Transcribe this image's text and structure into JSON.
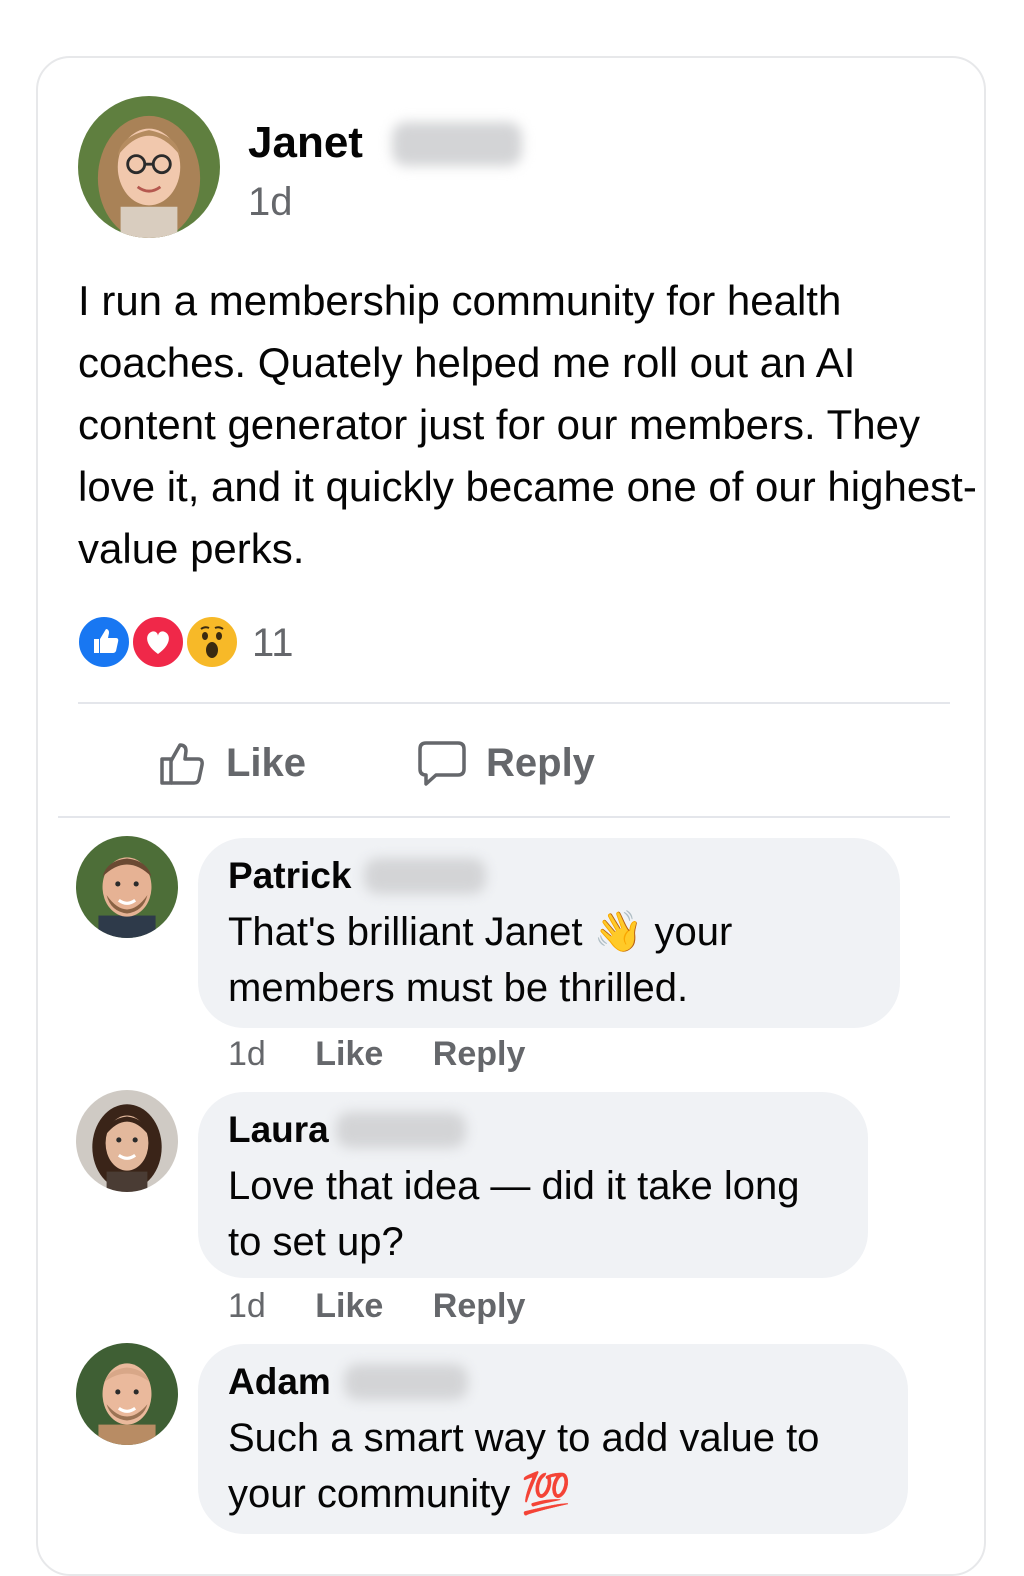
{
  "post": {
    "author": "Janet",
    "time": "1d",
    "body": "I run a membership community for health coaches. Quately helped me roll out an AI content generator just for our members. They love it, and it quickly became one of our highest-value perks.",
    "reactions": {
      "types": [
        "like-reaction",
        "love-reaction",
        "wow-reaction"
      ],
      "count": "11",
      "colors": {
        "like": "#1877f2",
        "love": "#f02849",
        "wow": "#f7b928"
      }
    },
    "actions": {
      "like_label": "Like",
      "reply_label": "Reply"
    }
  },
  "comments": [
    {
      "author": "Patrick",
      "text": "That's brilliant Janet 👋 your members must be thrilled.",
      "time": "1d",
      "like_label": "Like",
      "reply_label": "Reply"
    },
    {
      "author": "Laura",
      "text": "Love that idea — did it take long to set up?",
      "time": "1d",
      "like_label": "Like",
      "reply_label": "Reply"
    },
    {
      "author": "Adam",
      "text": "Such a smart way to add value to your community 💯",
      "time": "",
      "like_label": "",
      "reply_label": ""
    }
  ],
  "colors": {
    "text_primary": "#050505",
    "text_secondary": "#65676b",
    "bubble_bg": "#f0f2f5",
    "divider": "#e4e6eb"
  }
}
